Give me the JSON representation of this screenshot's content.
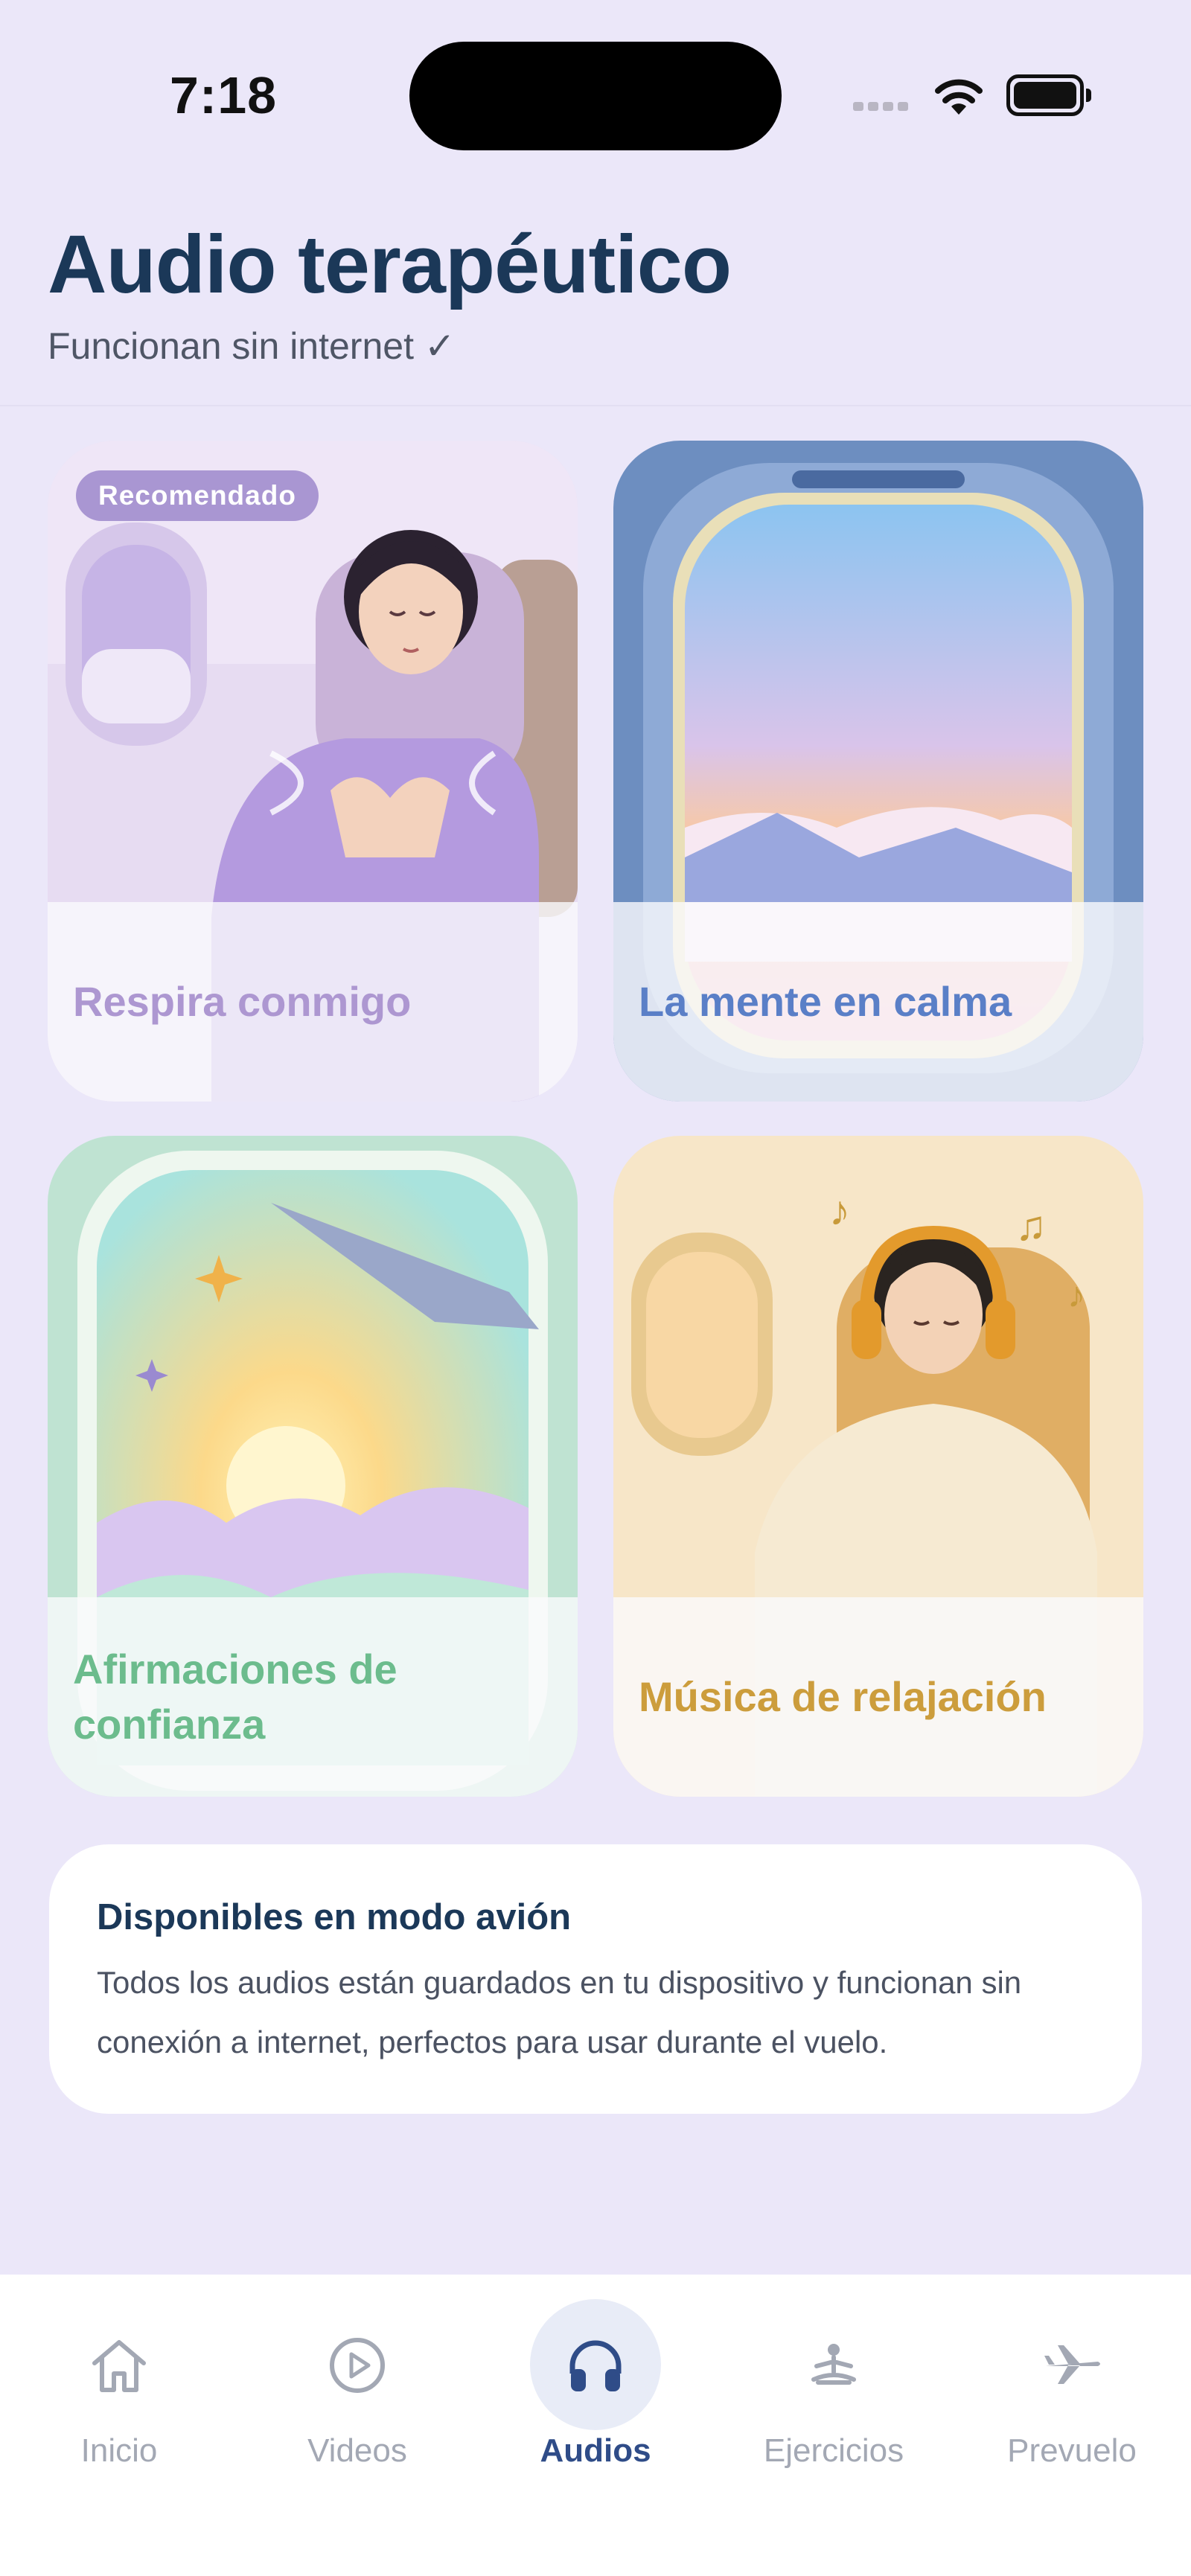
{
  "status_bar": {
    "time": "7:18"
  },
  "header": {
    "title": "Audio terapéutico",
    "subtitle": "Funcionan sin internet ✓"
  },
  "cards": [
    {
      "label": "Respira conmigo",
      "badge": "Recomendado",
      "label_color": "#ad97d1",
      "icon": "breathing-woman-illustration"
    },
    {
      "label": "La mente en calma",
      "label_color": "#5a7fc7",
      "icon": "airplane-window-sunset-illustration"
    },
    {
      "label": "Afirmaciones de confianza",
      "label_color": "#6cbc8d",
      "icon": "sunburst-clouds-wing-illustration"
    },
    {
      "label": "Música de relajación",
      "label_color": "#cc9d3c",
      "icon": "man-headphones-illustration"
    }
  ],
  "info": {
    "title": "Disponibles en modo avión",
    "text": "Todos los audios están guardados en tu dispositivo y funcionan sin conexión a internet, perfectos para usar durante el vuelo."
  },
  "tabbar": {
    "items": [
      {
        "label": "Inicio",
        "icon": "home-icon",
        "active": false
      },
      {
        "label": "Videos",
        "icon": "play-circle-icon",
        "active": false
      },
      {
        "label": "Audios",
        "icon": "headphones-icon",
        "active": true
      },
      {
        "label": "Ejercicios",
        "icon": "meditation-icon",
        "active": false
      },
      {
        "label": "Prevuelo",
        "icon": "airplane-icon",
        "active": false
      }
    ]
  },
  "colors": {
    "background": "#ebe7f9",
    "title": "#1b3858",
    "active_tab": "#2f4c88",
    "inactive_tab": "#a3a8b4"
  }
}
